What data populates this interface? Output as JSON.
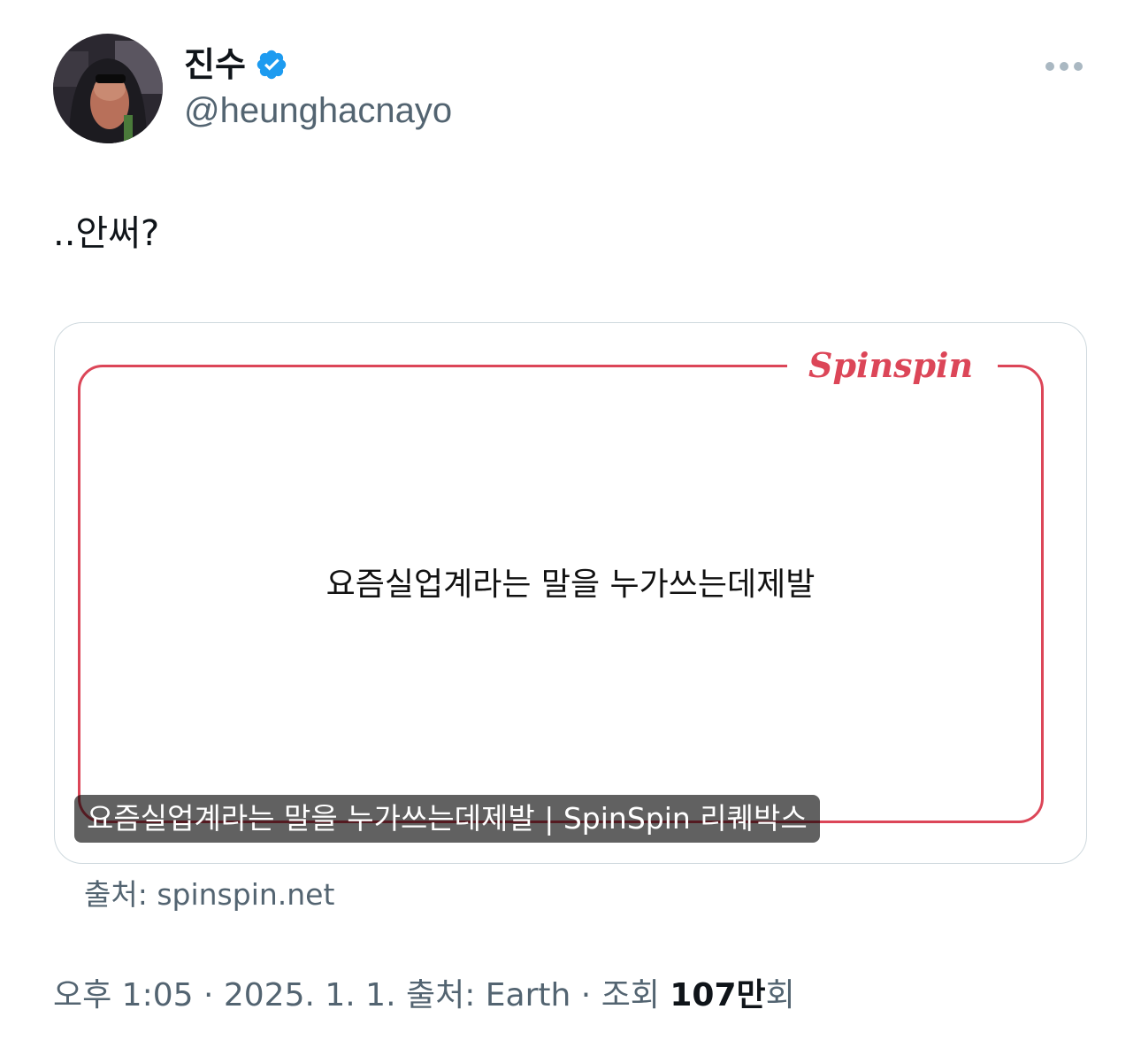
{
  "author": {
    "display_name": "진수",
    "handle": "@heunghacnayo",
    "verified": true,
    "verified_color": "#1d9bf0"
  },
  "tweet": {
    "text": "..안써?"
  },
  "card": {
    "brand": "Spinspin",
    "headline": "요즘실업계라는 말을 누가쓰는데제발",
    "caption": "요즘실업계라는 말을 누가쓰는데제발 | SpinSpin 리퀘박스",
    "source": "출처: spinspin.net",
    "accent_color": "#dc4658"
  },
  "meta": {
    "time": "오후 1:05",
    "separator": " · ",
    "date": "2025. 1. 1.",
    "via": "출처: Earth",
    "views_label_prefix": "조회 ",
    "views_number": "107만",
    "views_label_suffix": "회"
  },
  "icons": {
    "more": "more-horizontal-icon",
    "verified": "verified-badge-icon"
  }
}
